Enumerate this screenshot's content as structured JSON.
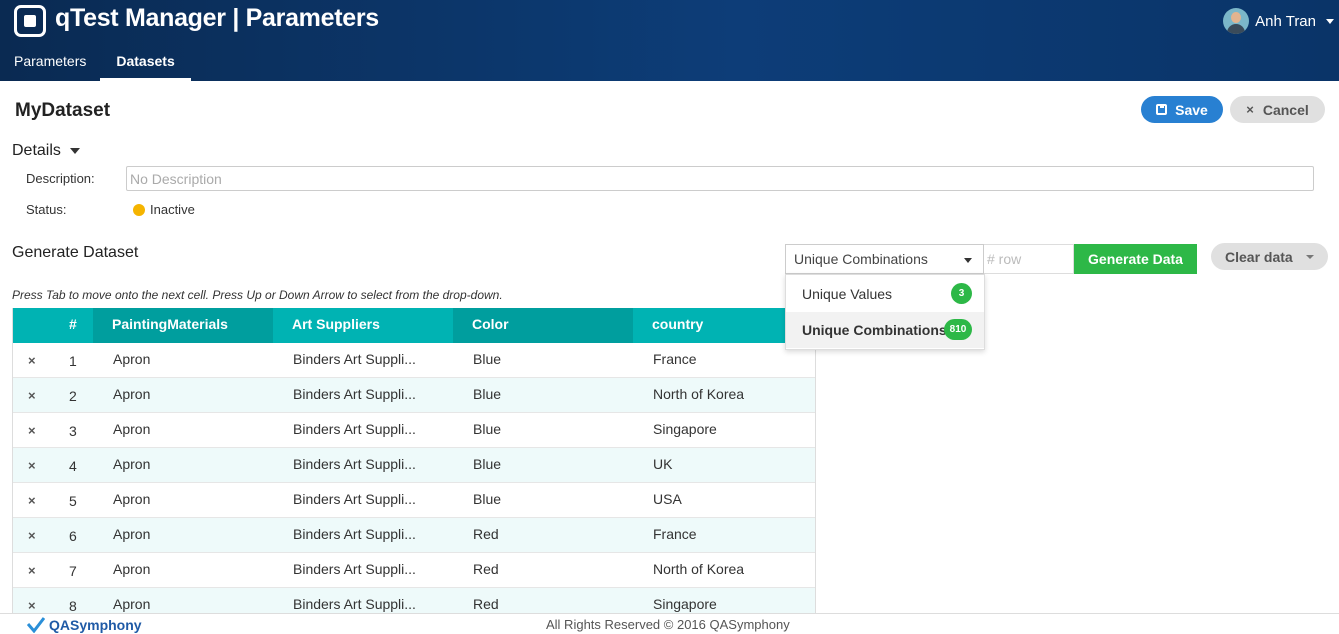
{
  "app": {
    "title": "qTest Manager | Parameters",
    "user_name": "Anh Tran"
  },
  "nav": {
    "tabs": [
      "Parameters",
      "Datasets"
    ],
    "active": "Datasets"
  },
  "page": {
    "title": "MyDataset"
  },
  "actions": {
    "save": "Save",
    "cancel": "Cancel"
  },
  "details": {
    "heading": "Details",
    "description_label": "Description:",
    "description_placeholder": "No Description",
    "status_label": "Status:",
    "status_value": "Inactive",
    "status_color": "#f5b400"
  },
  "generate": {
    "heading": "Generate Dataset",
    "mode_selected": "Unique Combinations",
    "row_placeholder": "# row",
    "generate_label": "Generate Data",
    "clear_label": "Clear data",
    "options": [
      {
        "label": "Unique Values",
        "count": "3"
      },
      {
        "label": "Unique Combinations",
        "count": "810"
      }
    ],
    "hint": "Press Tab to move onto the next cell. Press Up or Down Arrow to select from the drop-down."
  },
  "table": {
    "columns": [
      "#",
      "PaintingMaterials",
      "Art Suppliers",
      "Color",
      "country"
    ],
    "delete_icon": "×",
    "rows": [
      [
        "1",
        "Apron",
        "Binders Art Suppli...",
        "Blue",
        "France"
      ],
      [
        "2",
        "Apron",
        "Binders Art Suppli...",
        "Blue",
        "North of Korea"
      ],
      [
        "3",
        "Apron",
        "Binders Art Suppli...",
        "Blue",
        "Singapore"
      ],
      [
        "4",
        "Apron",
        "Binders Art Suppli...",
        "Blue",
        "UK"
      ],
      [
        "5",
        "Apron",
        "Binders Art Suppli...",
        "Blue",
        "USA"
      ],
      [
        "6",
        "Apron",
        "Binders Art Suppli...",
        "Red",
        "France"
      ],
      [
        "7",
        "Apron",
        "Binders Art Suppli...",
        "Red",
        "North of Korea"
      ],
      [
        "8",
        "Apron",
        "Binders Art Suppli...",
        "Red",
        "Singapore"
      ]
    ]
  },
  "footer": {
    "brand": "QASymphony",
    "copyright": "All Rights Reserved © 2016 QASymphony"
  },
  "colors": {
    "header": "#0d3d78",
    "accent_teal": "#00b3b3",
    "save_blue": "#2880d2",
    "generate_green": "#2db847"
  }
}
